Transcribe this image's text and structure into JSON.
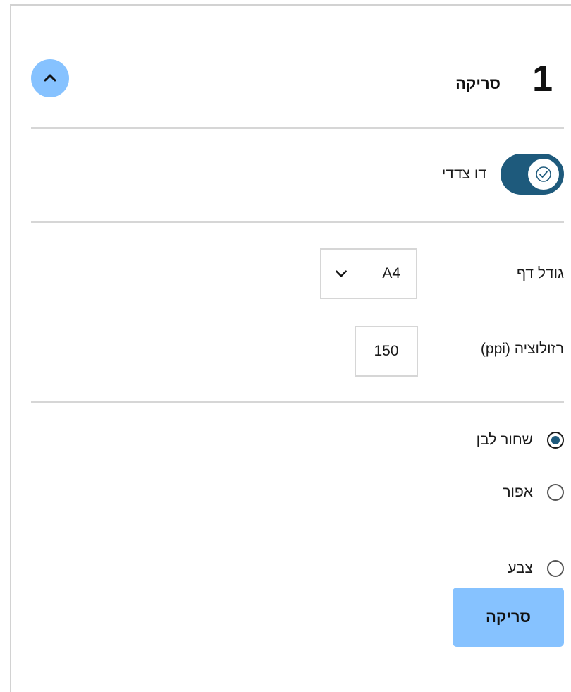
{
  "section": {
    "step_number": "1",
    "title": "סריקה",
    "collapse_icon": "chevron-up-icon"
  },
  "duplex": {
    "label": "דו צדדי",
    "enabled": true,
    "icon": "checkmark-icon"
  },
  "page_size": {
    "label": "גודל דף",
    "value": "A4",
    "icon": "chevron-down-icon"
  },
  "resolution": {
    "label": "רזולוציה (ppi)",
    "value": "150"
  },
  "color_mode": {
    "options": [
      {
        "label": "שחור לבן",
        "checked": true
      },
      {
        "label": "אפור",
        "checked": false
      },
      {
        "label": "צבע",
        "checked": false
      }
    ]
  },
  "scan_button": {
    "label": "סריקה"
  },
  "colors": {
    "accent": "#86c2ff",
    "toggle_on": "#1e5a7c",
    "divider": "#d6d6d6"
  }
}
